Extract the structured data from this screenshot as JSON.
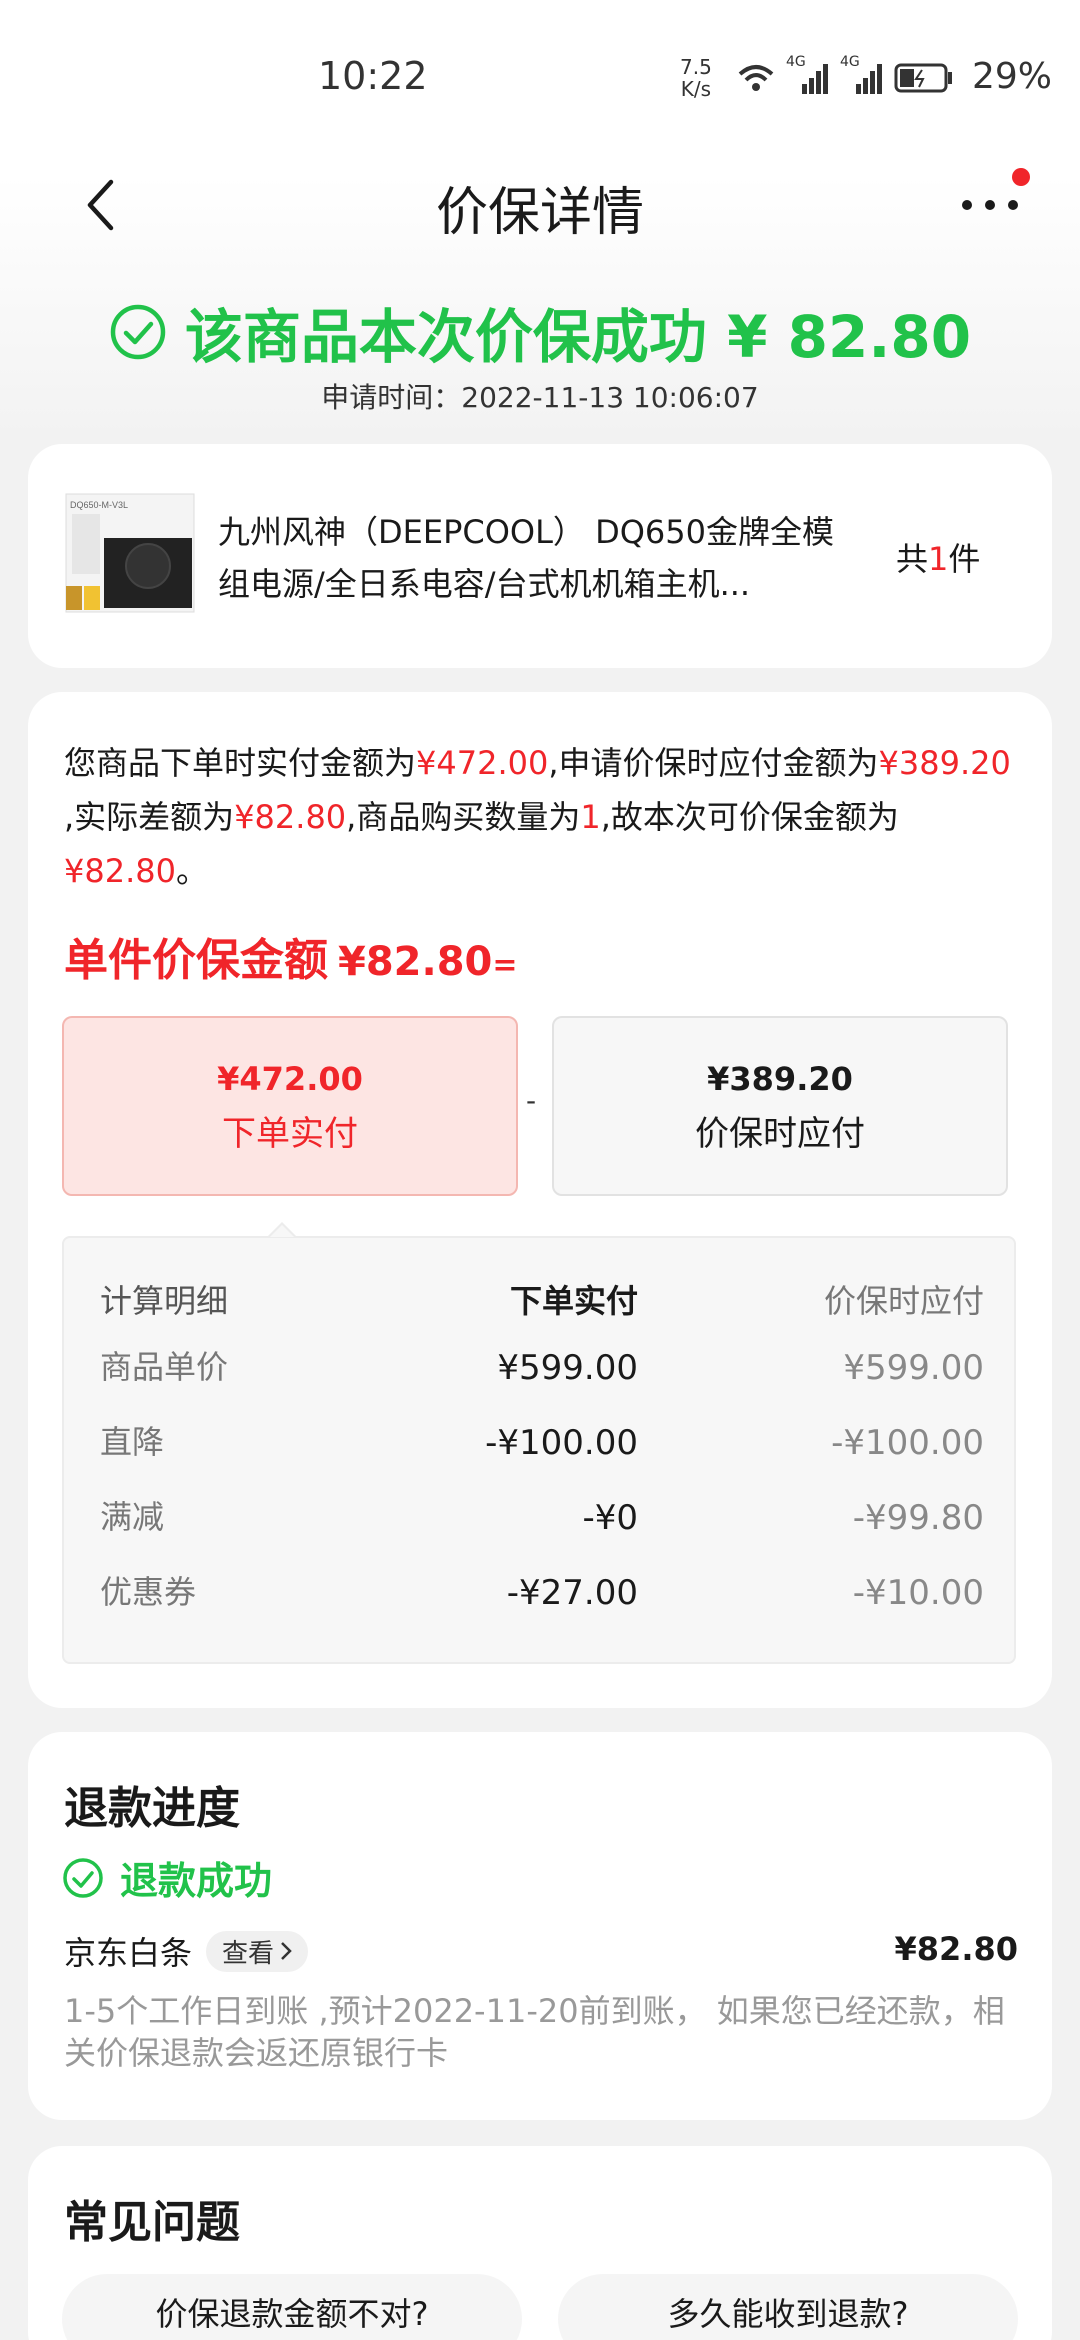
{
  "status_bar": {
    "time": "10:22",
    "net_speed_value": "7.5",
    "net_speed_unit": "K/s",
    "signal_1": "4G",
    "signal_2": "4G",
    "battery": "29%"
  },
  "nav": {
    "title": "价保详情"
  },
  "header": {
    "success_text": "该商品本次价保成功 ¥ 82.80",
    "apply_time": "申请时间：2022-11-13 10:06:07"
  },
  "product": {
    "image_label": "DQ650-M-V3L",
    "name": "九州风神（DEEPCOOL） DQ650金牌全模组电源/全日系电容/台式机机箱主机...",
    "count_prefix": "共",
    "count_value": "1",
    "count_suffix": "件"
  },
  "detail": {
    "desc_1": "您商品下单时实付金额为",
    "paid_amount": "¥472.00",
    "desc_2": ",申请价保时应付金额为",
    "protect_amount": "¥389.20",
    "desc_3": " ,实际差额为",
    "diff_amount": "¥82.80",
    "desc_4": ",商品购买数量为",
    "quantity": "1",
    "desc_5": ",故本次可价保金额为 ",
    "final_amount": "¥82.80",
    "desc_6": "。",
    "unit_label": "单件价保金额",
    "unit_amount": "¥82.80",
    "unit_eq": "=",
    "box_left_amount": "¥472.00",
    "box_left_label": "下单实付",
    "minus": "-",
    "box_right_amount": "¥389.20",
    "box_right_label": "价保时应付"
  },
  "calc_table": {
    "headers": [
      "计算明细",
      "下单实付",
      "价保时应付"
    ],
    "rows": [
      [
        "商品单价",
        "¥599.00",
        "¥599.00"
      ],
      [
        "直降",
        "-¥100.00",
        "-¥100.00"
      ],
      [
        "满减",
        "-¥0",
        "-¥99.80"
      ],
      [
        "优惠券",
        "-¥27.00",
        "-¥10.00"
      ]
    ]
  },
  "refund": {
    "title": "退款进度",
    "status": "退款成功",
    "method": "京东白条",
    "view_label": "查看",
    "amount": "¥82.80",
    "note": "1-5个工作日到账 ,预计2022-11-20前到账， 如果您已经还款，相关价保退款会返还原银行卡"
  },
  "faq": {
    "title": "常见问题",
    "items": [
      "价保退款金额不对?",
      "多久能收到退款?"
    ]
  },
  "colors": {
    "green": "#21c24a",
    "red": "#f0252a"
  }
}
